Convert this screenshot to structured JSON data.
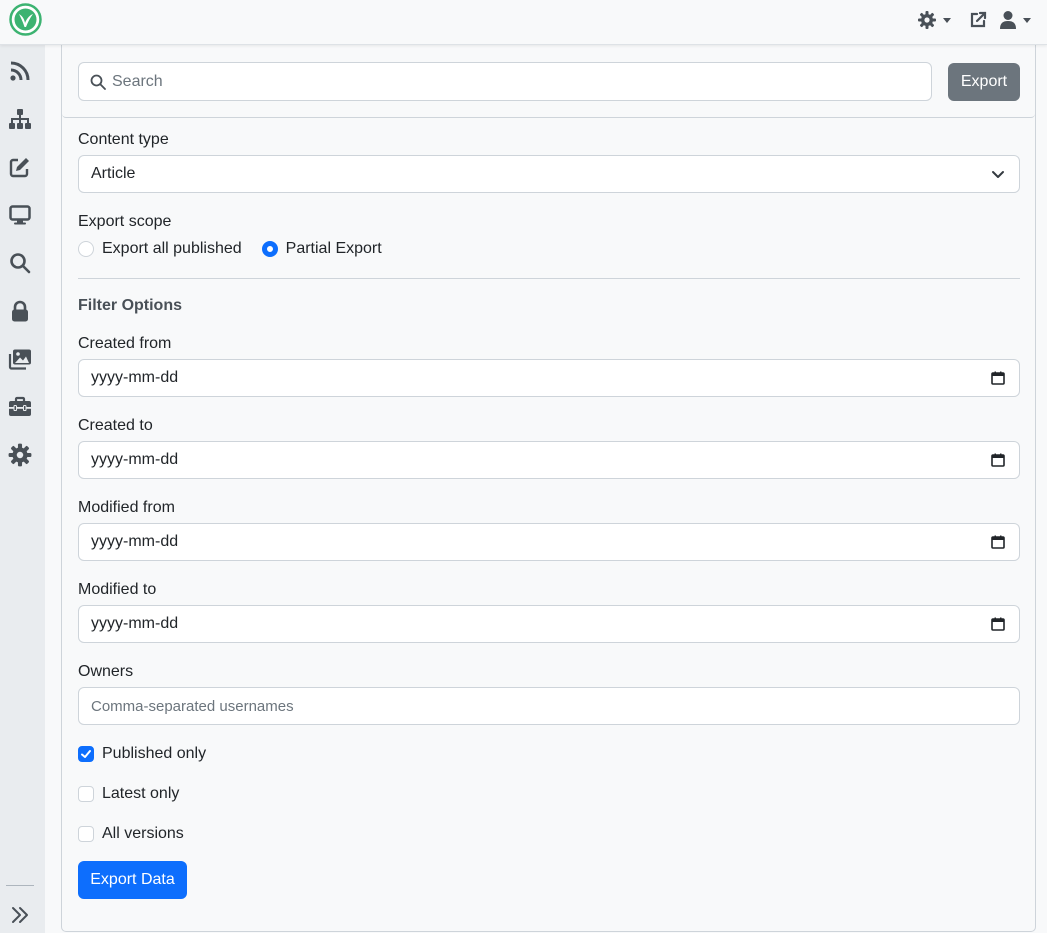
{
  "topbar": {
    "icons": [
      "logo-icon",
      "theme-gear-icon",
      "external-link-icon",
      "user-icon"
    ]
  },
  "sidebar": {
    "icons": [
      "rss-feed-icon",
      "sitemap-icon",
      "edit-icon",
      "desktop-icon",
      "search-icon",
      "lock-icon",
      "images-icon",
      "toolbox-icon",
      "gear-icon",
      "expand-chevrons-icon"
    ]
  },
  "search": {
    "placeholder": "Search",
    "value": "",
    "export_label": "Export"
  },
  "form": {
    "content_type_label": "Content type",
    "content_type_value": "Article",
    "export_scope_label": "Export scope",
    "scope_options": [
      "Export all published",
      "Partial Export"
    ],
    "scope_selected": "Partial Export",
    "filter_title": "Filter Options",
    "created_from_label": "Created from",
    "created_to_label": "Created to",
    "modified_from_label": "Modified from",
    "modified_to_label": "Modified to",
    "date_placeholder": "yyyy-mm-dd",
    "owners_label": "Owners",
    "owners_placeholder": "Comma-separated usernames",
    "published_only_label": "Published only",
    "published_only_checked": true,
    "latest_only_label": "Latest only",
    "latest_only_checked": false,
    "all_versions_label": "All versions",
    "all_versions_checked": false,
    "submit_label": "Export Data"
  },
  "colors": {
    "primary": "#0d6efd",
    "secondary": "#6c757d",
    "logo_green": "#3cb371"
  }
}
